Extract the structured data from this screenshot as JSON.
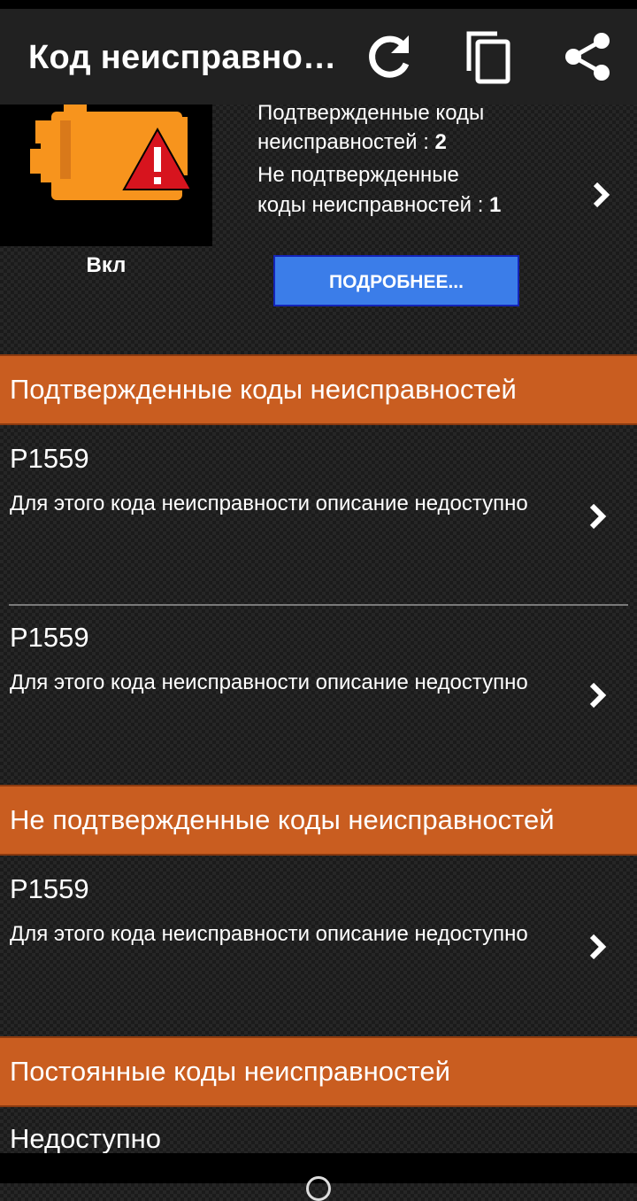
{
  "app_bar": {
    "title": "Код неисправно…",
    "icons": [
      "refresh-icon",
      "copy-icon",
      "share-icon"
    ]
  },
  "summary": {
    "engine_icon": "check-engine-warning-icon",
    "status_label": "Вкл",
    "confirmed_line1": "Подтвержденные коды",
    "confirmed_line2_text": "неисправностей : ",
    "confirmed_count": "2",
    "unconfirmed_line1": "Не подтвержденные",
    "unconfirmed_line2_text": "коды неисправностей : ",
    "unconfirmed_count": "1",
    "details_button": "ПОДРОБНЕЕ..."
  },
  "sections": {
    "confirmed": {
      "title": "Подтвержденные коды неисправностей",
      "items": [
        {
          "code": "P1559",
          "description": "Для этого кода неисправности описание недоступно"
        },
        {
          "code": "P1559",
          "description": "Для этого кода неисправности описание недоступно"
        }
      ]
    },
    "unconfirmed": {
      "title": "Не подтвержденные коды неисправностей",
      "items": [
        {
          "code": "P1559",
          "description": "Для этого кода неисправности описание недоступно"
        }
      ]
    },
    "permanent": {
      "title": "Постоянные коды неисправностей",
      "value": "Недоступно"
    }
  },
  "colors": {
    "section_header": "#c95d20",
    "button": "#3b7de9",
    "engine_icon": "#f7941d",
    "warning": "#d7141e"
  }
}
